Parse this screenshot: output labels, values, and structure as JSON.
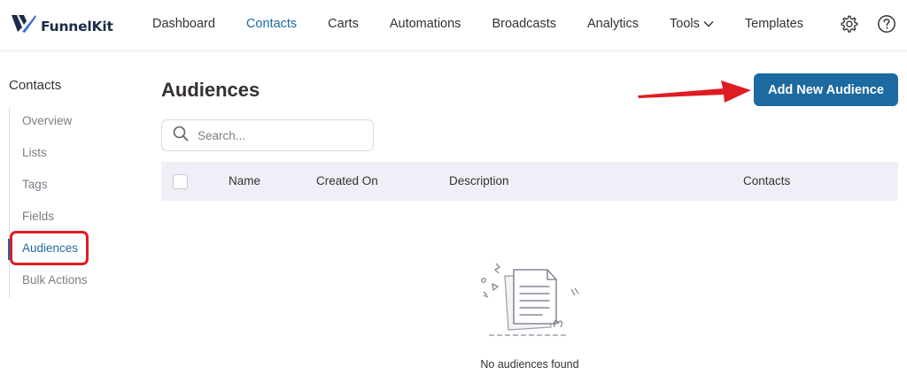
{
  "brand": {
    "name": "FunnelKit"
  },
  "nav": {
    "items": [
      {
        "label": "Dashboard"
      },
      {
        "label": "Contacts"
      },
      {
        "label": "Carts"
      },
      {
        "label": "Automations"
      },
      {
        "label": "Broadcasts"
      },
      {
        "label": "Analytics"
      },
      {
        "label": "Tools"
      },
      {
        "label": "Templates"
      }
    ],
    "active": "Contacts"
  },
  "sidebar": {
    "heading": "Contacts",
    "items": [
      {
        "label": "Overview"
      },
      {
        "label": "Lists"
      },
      {
        "label": "Tags"
      },
      {
        "label": "Fields"
      },
      {
        "label": "Audiences"
      },
      {
        "label": "Bulk Actions"
      }
    ],
    "active": "Audiences"
  },
  "main": {
    "title": "Audiences",
    "add_button_label": "Add New Audience",
    "search": {
      "placeholder": "Search...",
      "value": ""
    },
    "table": {
      "columns": [
        "Name",
        "Created On",
        "Description",
        "Contacts"
      ]
    },
    "empty_message": "No audiences found"
  },
  "colors": {
    "accent": "#1d6aa1",
    "annotation": "#e01b24",
    "header_bg": "#eff0f7"
  },
  "icons": [
    "funnelkit-logo-icon",
    "chevron-down-icon",
    "gear-icon",
    "help-icon",
    "search-icon",
    "red-arrow-icon",
    "empty-document-icon"
  ]
}
